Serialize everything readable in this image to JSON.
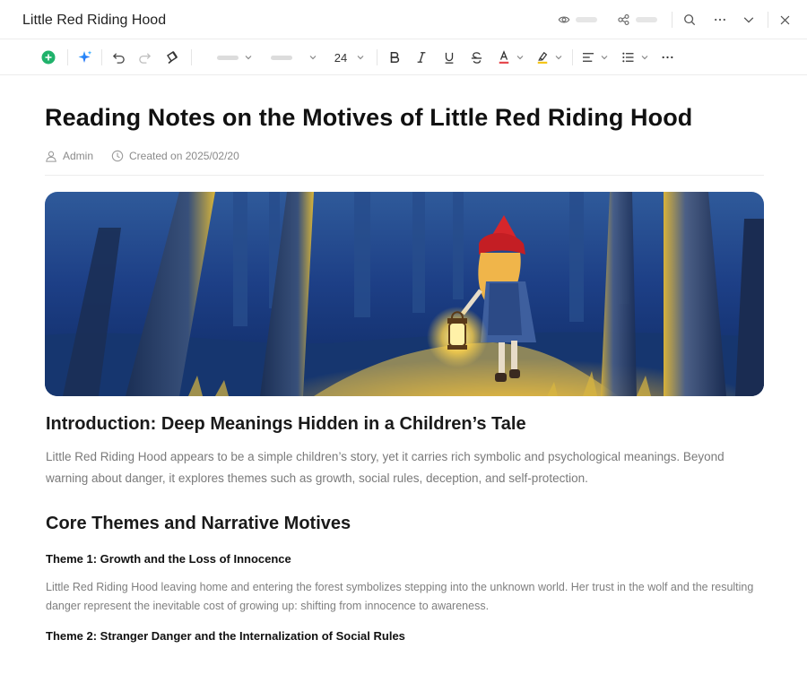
{
  "window": {
    "title": "Little Red Riding Hood"
  },
  "toolbar": {
    "font_size": "24"
  },
  "document": {
    "heading": "Reading Notes on the Motives of Little Red Riding Hood",
    "author": "Admin",
    "created": "Created on 2025/02/20",
    "sections": {
      "intro_title": "Introduction: Deep Meanings Hidden in a Children’s Tale",
      "intro_body": "Little Red Riding Hood appears to be a simple children’s story, yet it carries rich symbolic and psychological meanings. Beyond warning about danger, it explores themes such as growth, social rules, deception, and self-protection.",
      "core_title": "Core Themes and Narrative Motives",
      "theme1_title": "Theme 1: Growth and the Loss of Innocence",
      "theme1_body": "Little Red Riding Hood leaving home and entering the forest symbolizes stepping into the unknown world. Her trust in the wolf and the resulting danger represent the inevitable cost of growing up: shifting from innocence to awareness.",
      "theme2_title": "Theme 2: Stranger Danger and the Internalization of Social Rules"
    }
  },
  "colors": {
    "accent_green": "#20b26b",
    "ai_blue": "#1e7bf0",
    "text_color_red": "#e5484d",
    "highlight_yellow": "#f5c518"
  },
  "icons": {
    "add": "plus-circle-icon",
    "ai": "sparkle-icon",
    "undo": "undo-icon",
    "redo": "redo-icon",
    "format_painter": "format-painter-icon",
    "view": "eye-icon",
    "share": "share-icon",
    "search": "search-icon",
    "more": "more-icon",
    "collapse": "chevron-down-icon",
    "close": "close-icon"
  }
}
